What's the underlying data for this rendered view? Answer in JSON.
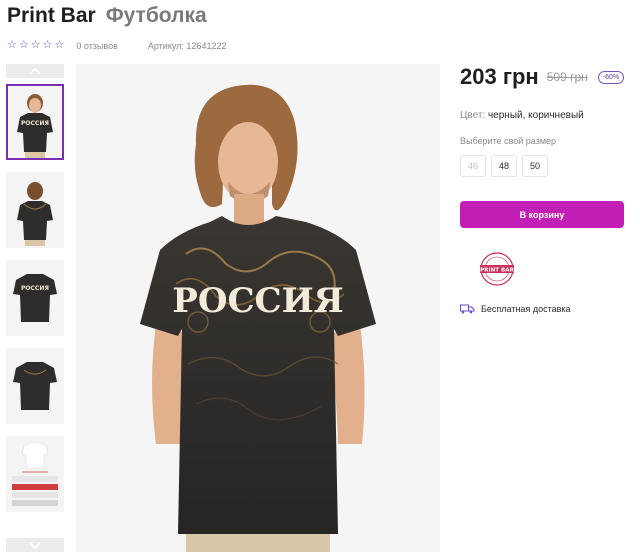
{
  "header": {
    "brand": "Print Bar",
    "product": "Футболка"
  },
  "meta": {
    "rating_stars": 5,
    "reviews": "0 отзывов",
    "article": "Артикул: 12641222"
  },
  "gallery": {
    "thumbnails": [
      {
        "name": "front-model",
        "active": true
      },
      {
        "name": "back-model",
        "active": false
      },
      {
        "name": "front-flat",
        "active": false
      },
      {
        "name": "back-flat",
        "active": false
      },
      {
        "name": "size-chart",
        "active": false
      }
    ],
    "main_print_text": "РОССИЯ"
  },
  "pricing": {
    "price": "203 грн",
    "old_price": "509 грн",
    "discount": "-60%"
  },
  "color": {
    "label": "Цвет:",
    "value": "черный, коричневый"
  },
  "size": {
    "label": "Выберите свой размер",
    "options": [
      {
        "label": "46",
        "available": false
      },
      {
        "label": "48",
        "available": true
      },
      {
        "label": "50",
        "available": true
      }
    ]
  },
  "cart": {
    "button_label": "В корзину"
  },
  "badge": {
    "text": "PRINT BAR"
  },
  "delivery": {
    "text": "Бесплатная доставка"
  },
  "colors": {
    "accent": "#c21fb6",
    "purple": "#6b48c8",
    "active_border": "#7a2fb3"
  }
}
